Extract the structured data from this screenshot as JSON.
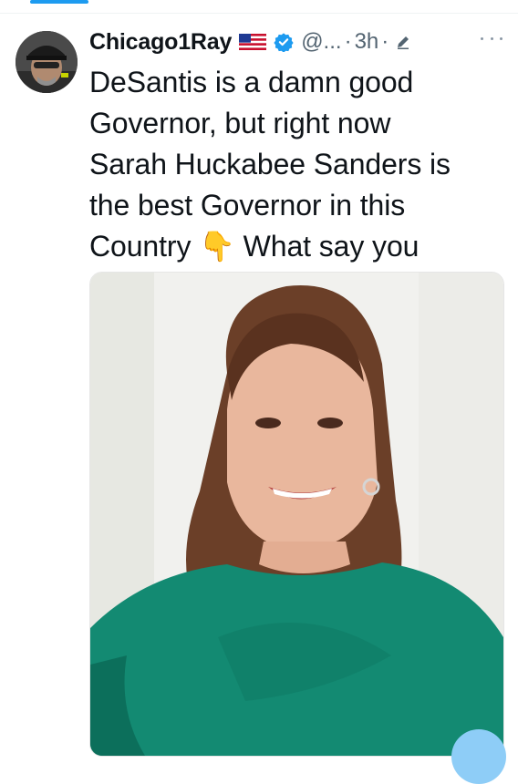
{
  "tweet": {
    "author": {
      "display_name": "Chicago1Ray",
      "flag": "us-flag-emoji",
      "verified": true,
      "handle": "@...",
      "avatar": "avatar-man-with-cap-and-headset"
    },
    "separator": "·",
    "time": "3h",
    "text": "DeSantis is a damn good\nGovernor, but right now\nSarah Huckabee Sanders is\nthe best Governor in this\nCountry 👇 What say you",
    "media": {
      "description": "Photo of smiling woman with long brown hair wearing a green top"
    }
  },
  "colors": {
    "accent": "#1d9bf0",
    "text": "#0f1419",
    "secondary_text": "#536471",
    "top_green": "#138a72"
  }
}
